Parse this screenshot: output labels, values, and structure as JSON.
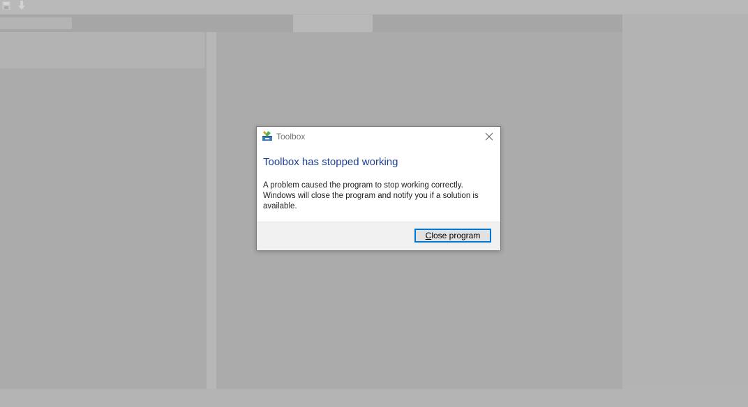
{
  "dialog": {
    "title": "Toolbox",
    "heading": "Toolbox has stopped working",
    "message_lines": [
      "A problem caused the program to stop working correctly.",
      "Windows will close the program and notify you if a solution is",
      "available."
    ],
    "button": {
      "mnemonic": "C",
      "rest": "lose program"
    },
    "icons": {
      "app": "toolbox-app-icon",
      "close": "close-icon"
    }
  },
  "app": {
    "toolbar_icons": [
      "save-icon",
      "download-arrow-icon"
    ]
  },
  "colors": {
    "overlay_background": "#b3b3b3",
    "heading": "#1c3f95",
    "button_border": "#0078d7",
    "footer": "#f0f0f0"
  }
}
